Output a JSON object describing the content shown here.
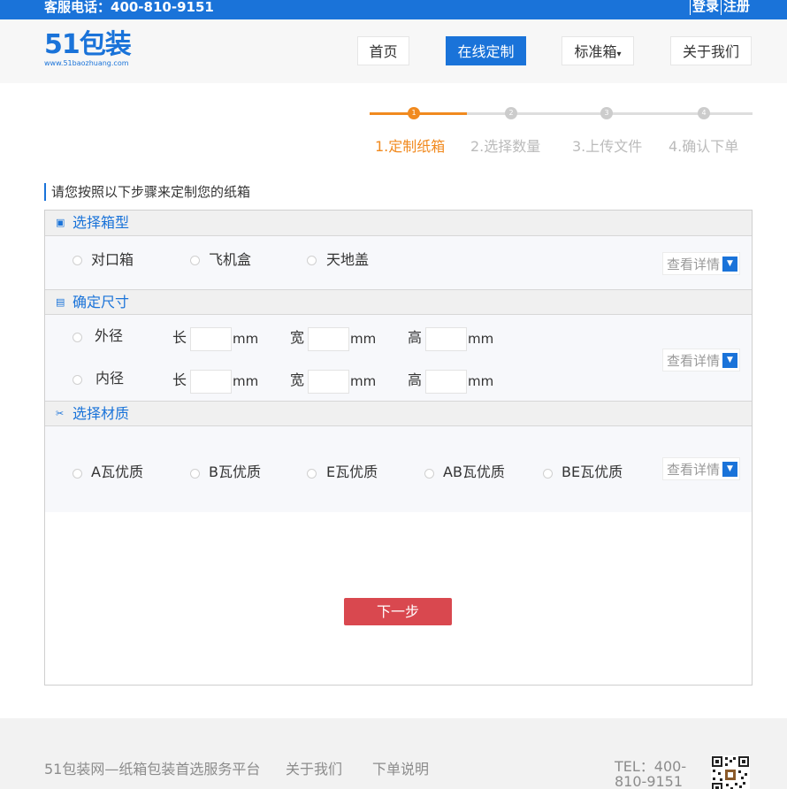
{
  "topbar": {
    "phone": "客服电话：400-810-9151",
    "login": "登录",
    "register": "注册"
  },
  "header": {
    "logo_main": "51包装",
    "logo_sub": "www.51baozhuang.com",
    "nav": {
      "home": "首页",
      "custom": "在线定制",
      "standard": "标准箱",
      "about": "关于我们"
    }
  },
  "steps": {
    "s1": "1",
    "s2": "2",
    "s3": "3",
    "s4": "4",
    "l1": "1.定制纸箱",
    "l2": "2.选择数量",
    "l3": "3.上传文件",
    "l4": "4.确认下单"
  },
  "instruction": "请您按照以下步骤来定制您的纸箱",
  "box_type": {
    "title": "选择箱型",
    "options": [
      "对口箱",
      "飞机盒",
      "天地盖"
    ],
    "detail": "查看详情"
  },
  "size": {
    "title": "确定尺寸",
    "outer": "外径",
    "inner": "内径",
    "length": "长",
    "width": "宽",
    "height": "高",
    "unit": "mm",
    "detail": "查看详情"
  },
  "material": {
    "title": "选择材质",
    "options": [
      "A瓦优质",
      "B瓦优质",
      "E瓦优质",
      "AB瓦优质",
      "BE瓦优质"
    ],
    "detail": "查看详情"
  },
  "next_button": "下一步",
  "footer": {
    "slogan": "51包装网—纸箱包装首选服务平台",
    "about": "关于我们",
    "order_help": "下单说明",
    "tel": "TEL：400-810-9151"
  }
}
